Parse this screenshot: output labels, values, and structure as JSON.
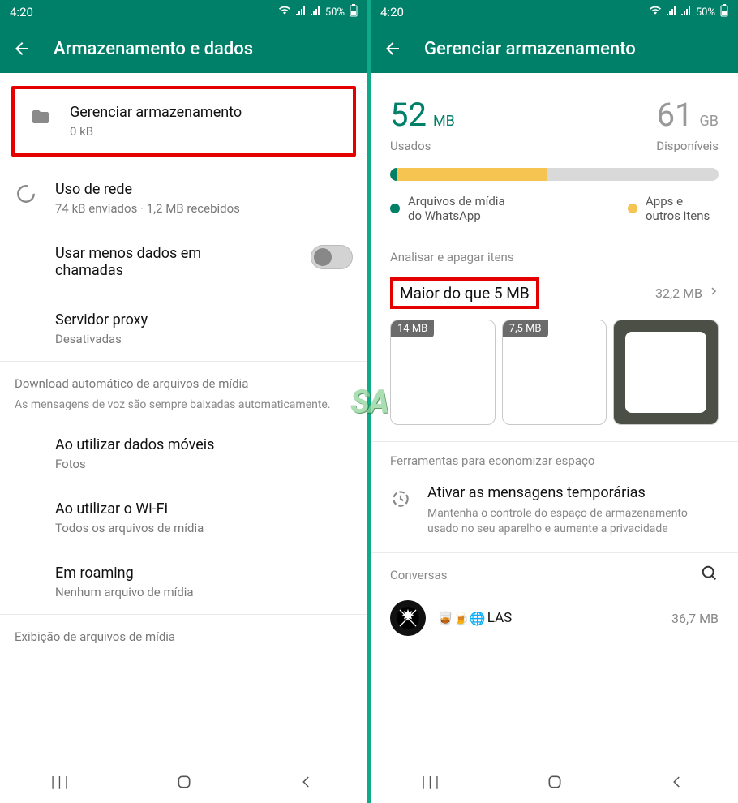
{
  "status": {
    "time": "4:20",
    "battery": "50%"
  },
  "left": {
    "title": "Armazenamento e dados",
    "manage": {
      "title": "Gerenciar armazenamento",
      "sub": "0 kB"
    },
    "network": {
      "title": "Uso de rede",
      "sub": "74 kB enviados · 1,2 MB recebidos"
    },
    "lessdata": {
      "title": "Usar menos dados em chamadas"
    },
    "proxy": {
      "title": "Servidor proxy",
      "sub": "Desativadas"
    },
    "autodl": {
      "header": "Download automático de arquivos de mídia",
      "note": "As mensagens de voz são sempre baixadas automaticamente.",
      "mobile": {
        "title": "Ao utilizar dados móveis",
        "sub": "Fotos"
      },
      "wifi": {
        "title": "Ao utilizar o Wi-Fi",
        "sub": "Todos os arquivos de mídia"
      },
      "roaming": {
        "title": "Em roaming",
        "sub": "Nenhum arquivo de mídia"
      }
    },
    "display": {
      "header": "Exibição de arquivos de mídia"
    }
  },
  "right": {
    "title": "Gerenciar armazenamento",
    "used_num": "52",
    "used_unit": "MB",
    "used_label": "Usados",
    "avail_num": "61",
    "avail_unit": "GB",
    "avail_label": "Disponíveis",
    "legend_a": "Arquivos de mídia do WhatsApp",
    "legend_b": "Apps e outros itens",
    "analyze_header": "Analisar e apagar itens",
    "larger_title": "Maior do que 5 MB",
    "larger_size": "32,2 MB",
    "thumbs": [
      {
        "label": "14 MB"
      },
      {
        "label": "7,5 MB"
      },
      {
        "label": ""
      }
    ],
    "tools_header": "Ferramentas para economizar espaço",
    "temp": {
      "title": "Ativar as mensagens temporárias",
      "sub": "Mantenha o controle do espaço de armazenamento usado no seu aparelho e aumente a privacidade"
    },
    "chats_header": "Conversas",
    "chat": {
      "name": "LAS",
      "emojis": "🥃🍺🌐",
      "size": "36,7 MB"
    }
  },
  "watermark": "SA"
}
